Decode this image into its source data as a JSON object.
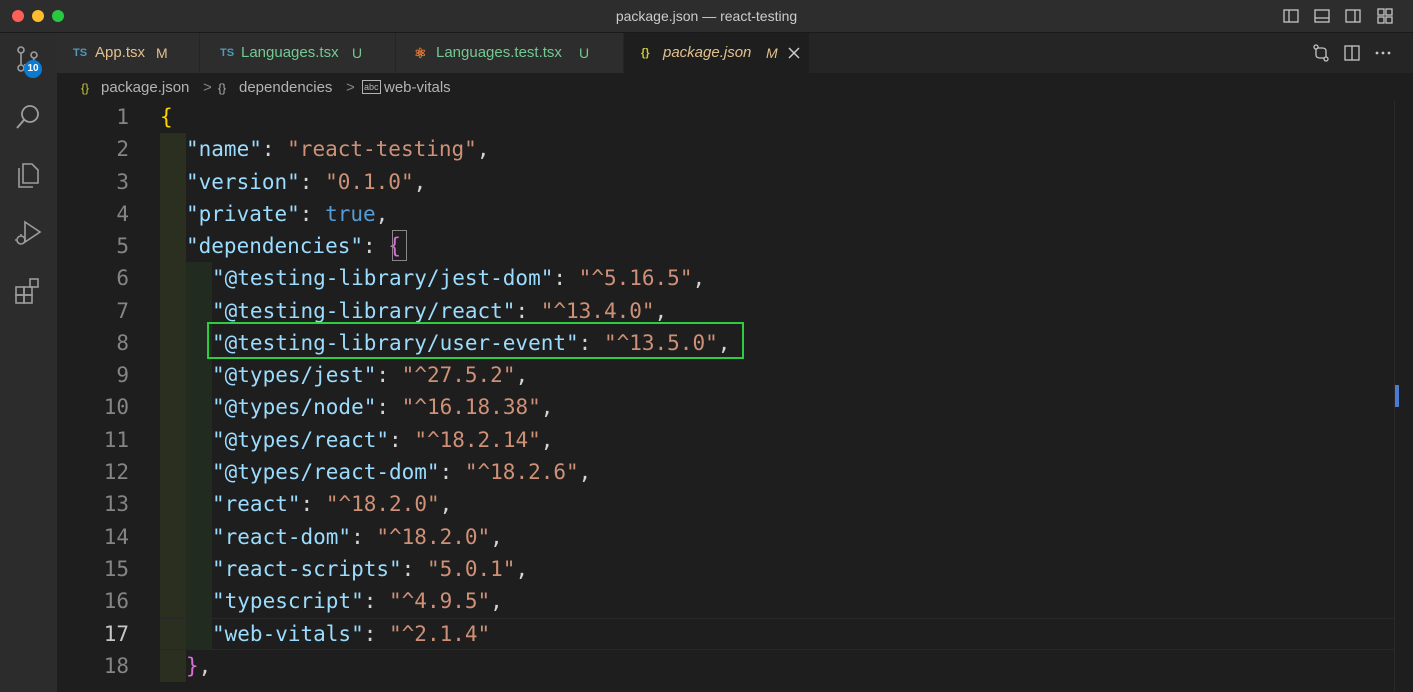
{
  "window": {
    "title": "package.json — react-testing"
  },
  "activity_bar": {
    "scm_badge": "10",
    "items": [
      "source-control",
      "search",
      "explorer",
      "run-and-debug",
      "extensions"
    ]
  },
  "tabs": [
    {
      "icon_text": "TS",
      "name": "App.tsx",
      "status": "M",
      "active": false
    },
    {
      "icon_text": "TS",
      "name": "Languages.tsx",
      "status": "U",
      "active": false
    },
    {
      "icon_text": "⚛",
      "name": "Languages.test.tsx",
      "status": "U",
      "active": false
    },
    {
      "icon_text": "{}",
      "name": "package.json",
      "status": "M",
      "active": true
    }
  ],
  "breadcrumb": {
    "file_icon": "{}",
    "file": "package.json",
    "sep1": ">",
    "obj_icon": "{}",
    "section": "dependencies",
    "sep2": ">",
    "prop_icon": "abc",
    "item": "web-vitals"
  },
  "editor": {
    "line_numbers": [
      "1",
      "2",
      "3",
      "4",
      "5",
      "6",
      "7",
      "8",
      "9",
      "10",
      "11",
      "12",
      "13",
      "14",
      "15",
      "16",
      "17",
      "18"
    ],
    "current_line": "17",
    "lines": {
      "l1": {
        "brace": "{"
      },
      "l2": {
        "key": "\"name\"",
        "colon": ": ",
        "value": "\"react-testing\"",
        "comma": ","
      },
      "l3": {
        "key": "\"version\"",
        "colon": ": ",
        "value": "\"0.1.0\"",
        "comma": ","
      },
      "l4": {
        "key": "\"private\"",
        "colon": ": ",
        "value": "true",
        "comma": ","
      },
      "l5": {
        "key": "\"dependencies\"",
        "colon": ": ",
        "brace": "{"
      },
      "l6": {
        "key": "\"@testing-library/jest-dom\"",
        "colon": ": ",
        "value": "\"^5.16.5\"",
        "comma": ","
      },
      "l7": {
        "key": "\"@testing-library/react\"",
        "colon": ": ",
        "value": "\"^13.4.0\"",
        "comma": ","
      },
      "l8": {
        "key": "\"@testing-library/user-event\"",
        "colon": ": ",
        "value": "\"^13.5.0\"",
        "comma": ","
      },
      "l9": {
        "key": "\"@types/jest\"",
        "colon": ": ",
        "value": "\"^27.5.2\"",
        "comma": ","
      },
      "l10": {
        "key": "\"@types/node\"",
        "colon": ": ",
        "value": "\"^16.18.38\"",
        "comma": ","
      },
      "l11": {
        "key": "\"@types/react\"",
        "colon": ": ",
        "value": "\"^18.2.14\"",
        "comma": ","
      },
      "l12": {
        "key": "\"@types/react-dom\"",
        "colon": ": ",
        "value": "\"^18.2.6\"",
        "comma": ","
      },
      "l13": {
        "key": "\"react\"",
        "colon": ": ",
        "value": "\"^18.2.0\"",
        "comma": ","
      },
      "l14": {
        "key": "\"react-dom\"",
        "colon": ": ",
        "value": "\"^18.2.0\"",
        "comma": ","
      },
      "l15": {
        "key": "\"react-scripts\"",
        "colon": ": ",
        "value": "\"5.0.1\"",
        "comma": ","
      },
      "l16": {
        "key": "\"typescript\"",
        "colon": ": ",
        "value": "\"^4.9.5\"",
        "comma": ","
      },
      "l17": {
        "key": "\"web-vitals\"",
        "colon": ": ",
        "value": "\"^2.1.4\""
      },
      "l18": {
        "brace": "}",
        "comma": ","
      }
    }
  },
  "colors": {
    "key": "#9cdcfe",
    "string": "#ce9178",
    "boolean": "#569cd6",
    "brace_level1": "#ffd700",
    "brace_level2": "#da70d6",
    "highlight_box": "#2ecc40",
    "modified": "#e2c08d",
    "untracked": "#73c991"
  }
}
